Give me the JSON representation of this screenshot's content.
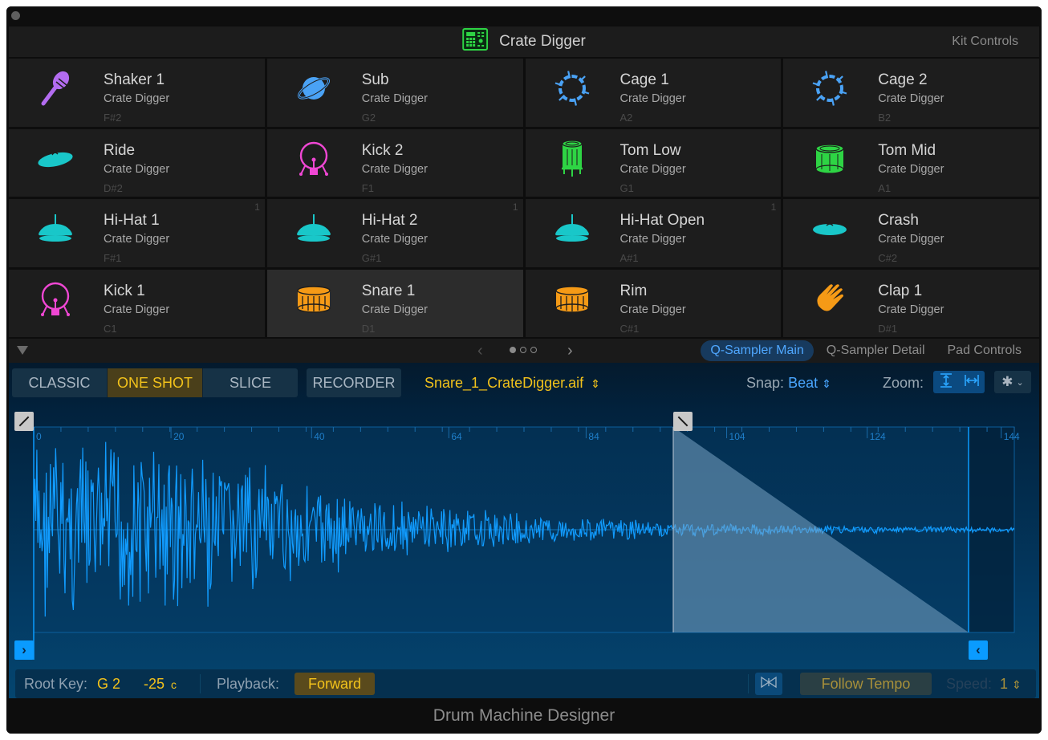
{
  "window": {
    "footer_title": "Drum Machine Designer"
  },
  "kit_header": {
    "title": "Crate Digger",
    "icon": "drum-machine-icon",
    "kit_controls_label": "Kit Controls"
  },
  "pads": [
    {
      "name": "Shaker 1",
      "kit": "Crate Digger",
      "note": "F#2",
      "icon": "maraca-icon",
      "color": "#b36cf0",
      "choke": ""
    },
    {
      "name": "Sub",
      "kit": "Crate Digger",
      "note": "G2",
      "icon": "planet-icon",
      "color": "#4aa2f5",
      "choke": ""
    },
    {
      "name": "Cage 1",
      "kit": "Crate Digger",
      "note": "A2",
      "icon": "cage-icon",
      "color": "#4aa2f5",
      "choke": ""
    },
    {
      "name": "Cage 2",
      "kit": "Crate Digger",
      "note": "B2",
      "icon": "cage-icon",
      "color": "#4aa2f5",
      "choke": ""
    },
    {
      "name": "Ride",
      "kit": "Crate Digger",
      "note": "D#2",
      "icon": "ride-cymbal-icon",
      "color": "#19c7c9",
      "choke": ""
    },
    {
      "name": "Kick 2",
      "kit": "Crate Digger",
      "note": "F1",
      "icon": "kick-drum-icon",
      "color": "#f047d4",
      "choke": ""
    },
    {
      "name": "Tom Low",
      "kit": "Crate Digger",
      "note": "G1",
      "icon": "floor-tom-icon",
      "color": "#2ed444",
      "choke": ""
    },
    {
      "name": "Tom Mid",
      "kit": "Crate Digger",
      "note": "A1",
      "icon": "tom-icon",
      "color": "#2ed444",
      "choke": ""
    },
    {
      "name": "Hi-Hat 1",
      "kit": "Crate Digger",
      "note": "F#1",
      "icon": "hihat-icon",
      "color": "#19c7c9",
      "choke": "1"
    },
    {
      "name": "Hi-Hat 2",
      "kit": "Crate Digger",
      "note": "G#1",
      "icon": "hihat-icon",
      "color": "#19c7c9",
      "choke": "1"
    },
    {
      "name": "Hi-Hat Open",
      "kit": "Crate Digger",
      "note": "A#1",
      "icon": "hihat-icon",
      "color": "#19c7c9",
      "choke": "1"
    },
    {
      "name": "Crash",
      "kit": "Crate Digger",
      "note": "C#2",
      "icon": "crash-cymbal-icon",
      "color": "#19c7c9",
      "choke": ""
    },
    {
      "name": "Kick 1",
      "kit": "Crate Digger",
      "note": "C1",
      "icon": "kick-drum-icon",
      "color": "#f047d4",
      "choke": ""
    },
    {
      "name": "Snare 1",
      "kit": "Crate Digger",
      "note": "D1",
      "icon": "snare-drum-icon",
      "color": "#f59a16",
      "choke": "",
      "selected": true
    },
    {
      "name": "Rim",
      "kit": "Crate Digger",
      "note": "C#1",
      "icon": "snare-drum-icon",
      "color": "#f59a16",
      "choke": ""
    },
    {
      "name": "Clap 1",
      "kit": "Crate Digger",
      "note": "D#1",
      "icon": "hand-clap-icon",
      "color": "#f59a16",
      "choke": ""
    }
  ],
  "pager": {
    "prev": "‹",
    "next": "›",
    "pages": 3,
    "current_page": 1
  },
  "tabs": [
    {
      "label": "Q-Sampler Main",
      "active": true
    },
    {
      "label": "Q-Sampler Detail",
      "active": false
    },
    {
      "label": "Pad Controls",
      "active": false
    }
  ],
  "sampler": {
    "modes": [
      {
        "label": "CLASSIC",
        "active": false
      },
      {
        "label": "ONE SHOT",
        "active": true
      },
      {
        "label": "SLICE",
        "active": false
      }
    ],
    "recorder_label": "RECORDER",
    "filename": "Snare_1_CrateDigger.aif",
    "snap_label": "Snap:",
    "snap_value": "Beat",
    "zoom_label": "Zoom:",
    "ruler_ticks": [
      "0",
      "20",
      "40",
      "64",
      "84",
      "104",
      "124",
      "144"
    ],
    "root_key_label": "Root Key:",
    "root_key_value": "G 2",
    "tune_value": "-25",
    "tune_unit": "c",
    "playback_label": "Playback:",
    "playback_value": "Forward",
    "follow_tempo_label": "Follow Tempo",
    "speed_label": "Speed:",
    "speed_value": "1"
  },
  "colors": {
    "accent_blue": "#0a9bff",
    "accent_yellow": "#f2c21b",
    "waveform": "#119cff"
  }
}
